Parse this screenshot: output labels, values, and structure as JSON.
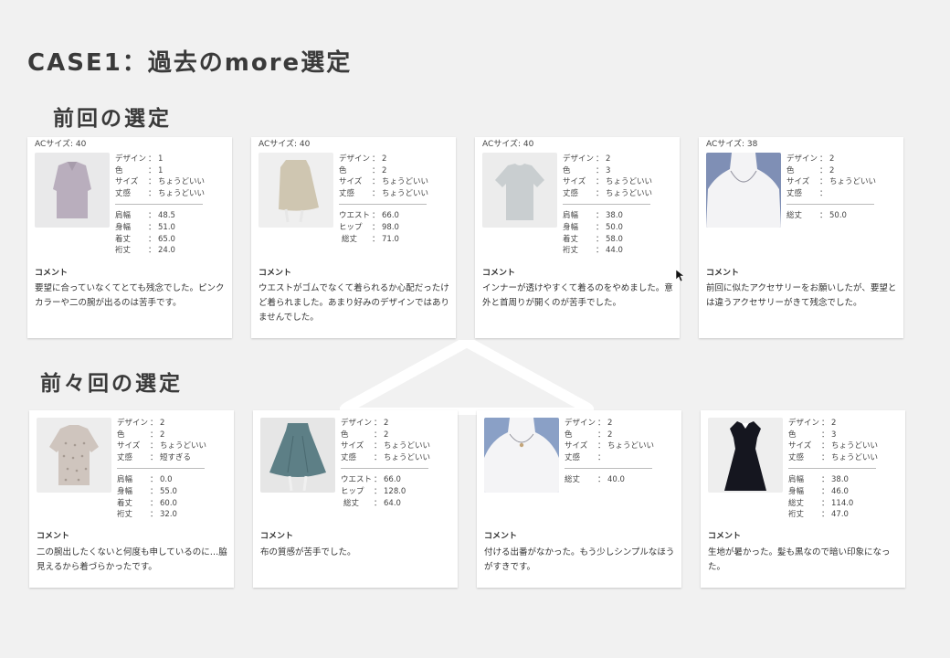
{
  "title": "CASE1：過去のmore選定",
  "section_previous": {
    "title": "前回の選定",
    "cards": [
      {
        "ac": "ACサイズ: 40",
        "icon": "blouse-icon",
        "attrs": [
          [
            "デザイン",
            "1"
          ],
          [
            "色",
            "1"
          ],
          [
            "サイズ",
            "ちょうどいい"
          ],
          [
            "丈感",
            "ちょうどいい"
          ]
        ],
        "measures": [
          [
            "肩幅",
            "48.5"
          ],
          [
            "身幅",
            "51.0"
          ],
          [
            "着丈",
            "65.0"
          ],
          [
            "裄丈",
            "24.0"
          ]
        ],
        "comment_label": "コメント",
        "comment": "要望に合っていなくてとても残念でした。ピンクカラーや二の腕が出るのは苦手です。"
      },
      {
        "ac": "ACサイズ: 40",
        "icon": "skirt-icon",
        "attrs": [
          [
            "デザイン",
            "2"
          ],
          [
            "色",
            "2"
          ],
          [
            "サイズ",
            "ちょうどいい"
          ],
          [
            "丈感",
            "ちょうどいい"
          ]
        ],
        "measures": [
          [
            "ウエスト",
            "66.0"
          ],
          [
            "ヒップ",
            "98.0"
          ],
          [
            "総丈",
            "71.0"
          ]
        ],
        "comment_label": "コメント",
        "comment": "ウエストがゴムでなくて着られるか心配だったけど着られました。あまり好みのデザインではありませんでした。"
      },
      {
        "ac": "ACサイズ: 40",
        "icon": "tshirt-icon",
        "attrs": [
          [
            "デザイン",
            "2"
          ],
          [
            "色",
            "3"
          ],
          [
            "サイズ",
            "ちょうどいい"
          ],
          [
            "丈感",
            "ちょうどいい"
          ]
        ],
        "measures": [
          [
            "肩幅",
            "38.0"
          ],
          [
            "身幅",
            "50.0"
          ],
          [
            "着丈",
            "58.0"
          ],
          [
            "裄丈",
            "44.0"
          ]
        ],
        "comment_label": "コメント",
        "comment": "インナーが透けやすくて着るのをやめました。意外と首周りが開くのが苦手でした。"
      },
      {
        "ac": "ACサイズ: 38",
        "icon": "necklace-icon",
        "attrs": [
          [
            "デザイン",
            "2"
          ],
          [
            "色",
            "2"
          ],
          [
            "サイズ",
            "ちょうどいい"
          ],
          [
            "丈感",
            ""
          ]
        ],
        "measures": [
          [
            "総丈",
            "50.0"
          ]
        ],
        "comment_label": "コメント",
        "comment": "前回に似たアクセサリーをお願いしたが、要望とは違うアクセサリーがきて残念でした。"
      }
    ]
  },
  "section_before": {
    "title": "前々回の選定",
    "cards": [
      {
        "icon": "dotted-blouse-icon",
        "attrs": [
          [
            "デザイン",
            "2"
          ],
          [
            "色",
            "2"
          ],
          [
            "サイズ",
            "ちょうどいい"
          ],
          [
            "丈感",
            "短すぎる"
          ]
        ],
        "measures": [
          [
            "肩幅",
            "0.0"
          ],
          [
            "身幅",
            "55.0"
          ],
          [
            "着丈",
            "60.0"
          ],
          [
            "裄丈",
            "32.0"
          ]
        ],
        "comment_label": "コメント",
        "comment": "二の腕出したくないと何度も申しているのに…脇見えるから着づらかったです。"
      },
      {
        "icon": "flared-skirt-icon",
        "attrs": [
          [
            "デザイン",
            "2"
          ],
          [
            "色",
            "2"
          ],
          [
            "サイズ",
            "ちょうどいい"
          ],
          [
            "丈感",
            "ちょうどいい"
          ]
        ],
        "measures": [
          [
            "ウエスト",
            "66.0"
          ],
          [
            "ヒップ",
            "128.0"
          ],
          [
            "総丈",
            "64.0"
          ]
        ],
        "comment_label": "コメント",
        "comment": "布の質感が苦手でした。"
      },
      {
        "icon": "pendant-icon",
        "attrs": [
          [
            "デザイン",
            "2"
          ],
          [
            "色",
            "2"
          ],
          [
            "サイズ",
            "ちょうどいい"
          ],
          [
            "丈感",
            ""
          ]
        ],
        "measures": [
          [
            "総丈",
            "40.0"
          ]
        ],
        "comment_label": "コメント",
        "comment": "付ける出番がなかった。もう少しシンプルなほうがすきです。"
      },
      {
        "icon": "dress-icon",
        "attrs": [
          [
            "デザイン",
            "2"
          ],
          [
            "色",
            "3"
          ],
          [
            "サイズ",
            "ちょうどいい"
          ],
          [
            "丈感",
            "ちょうどいい"
          ]
        ],
        "measures": [
          [
            "肩幅",
            "38.0"
          ],
          [
            "身幅",
            "46.0"
          ],
          [
            "総丈",
            "114.0"
          ],
          [
            "裄丈",
            "47.0"
          ]
        ],
        "comment_label": "コメント",
        "comment": "生地が暑かった。髪も黒なので暗い印象になった。"
      }
    ]
  },
  "colors": {
    "background": "#f1f1f1",
    "card": "#ffffff",
    "blouse": "#b9aebd",
    "skirt": "#cfc6b1",
    "tshirt": "#c9ced0",
    "necklace_bg": "#7f8fb5",
    "flared_skirt": "#5d7f86",
    "dress": "#15161f"
  }
}
